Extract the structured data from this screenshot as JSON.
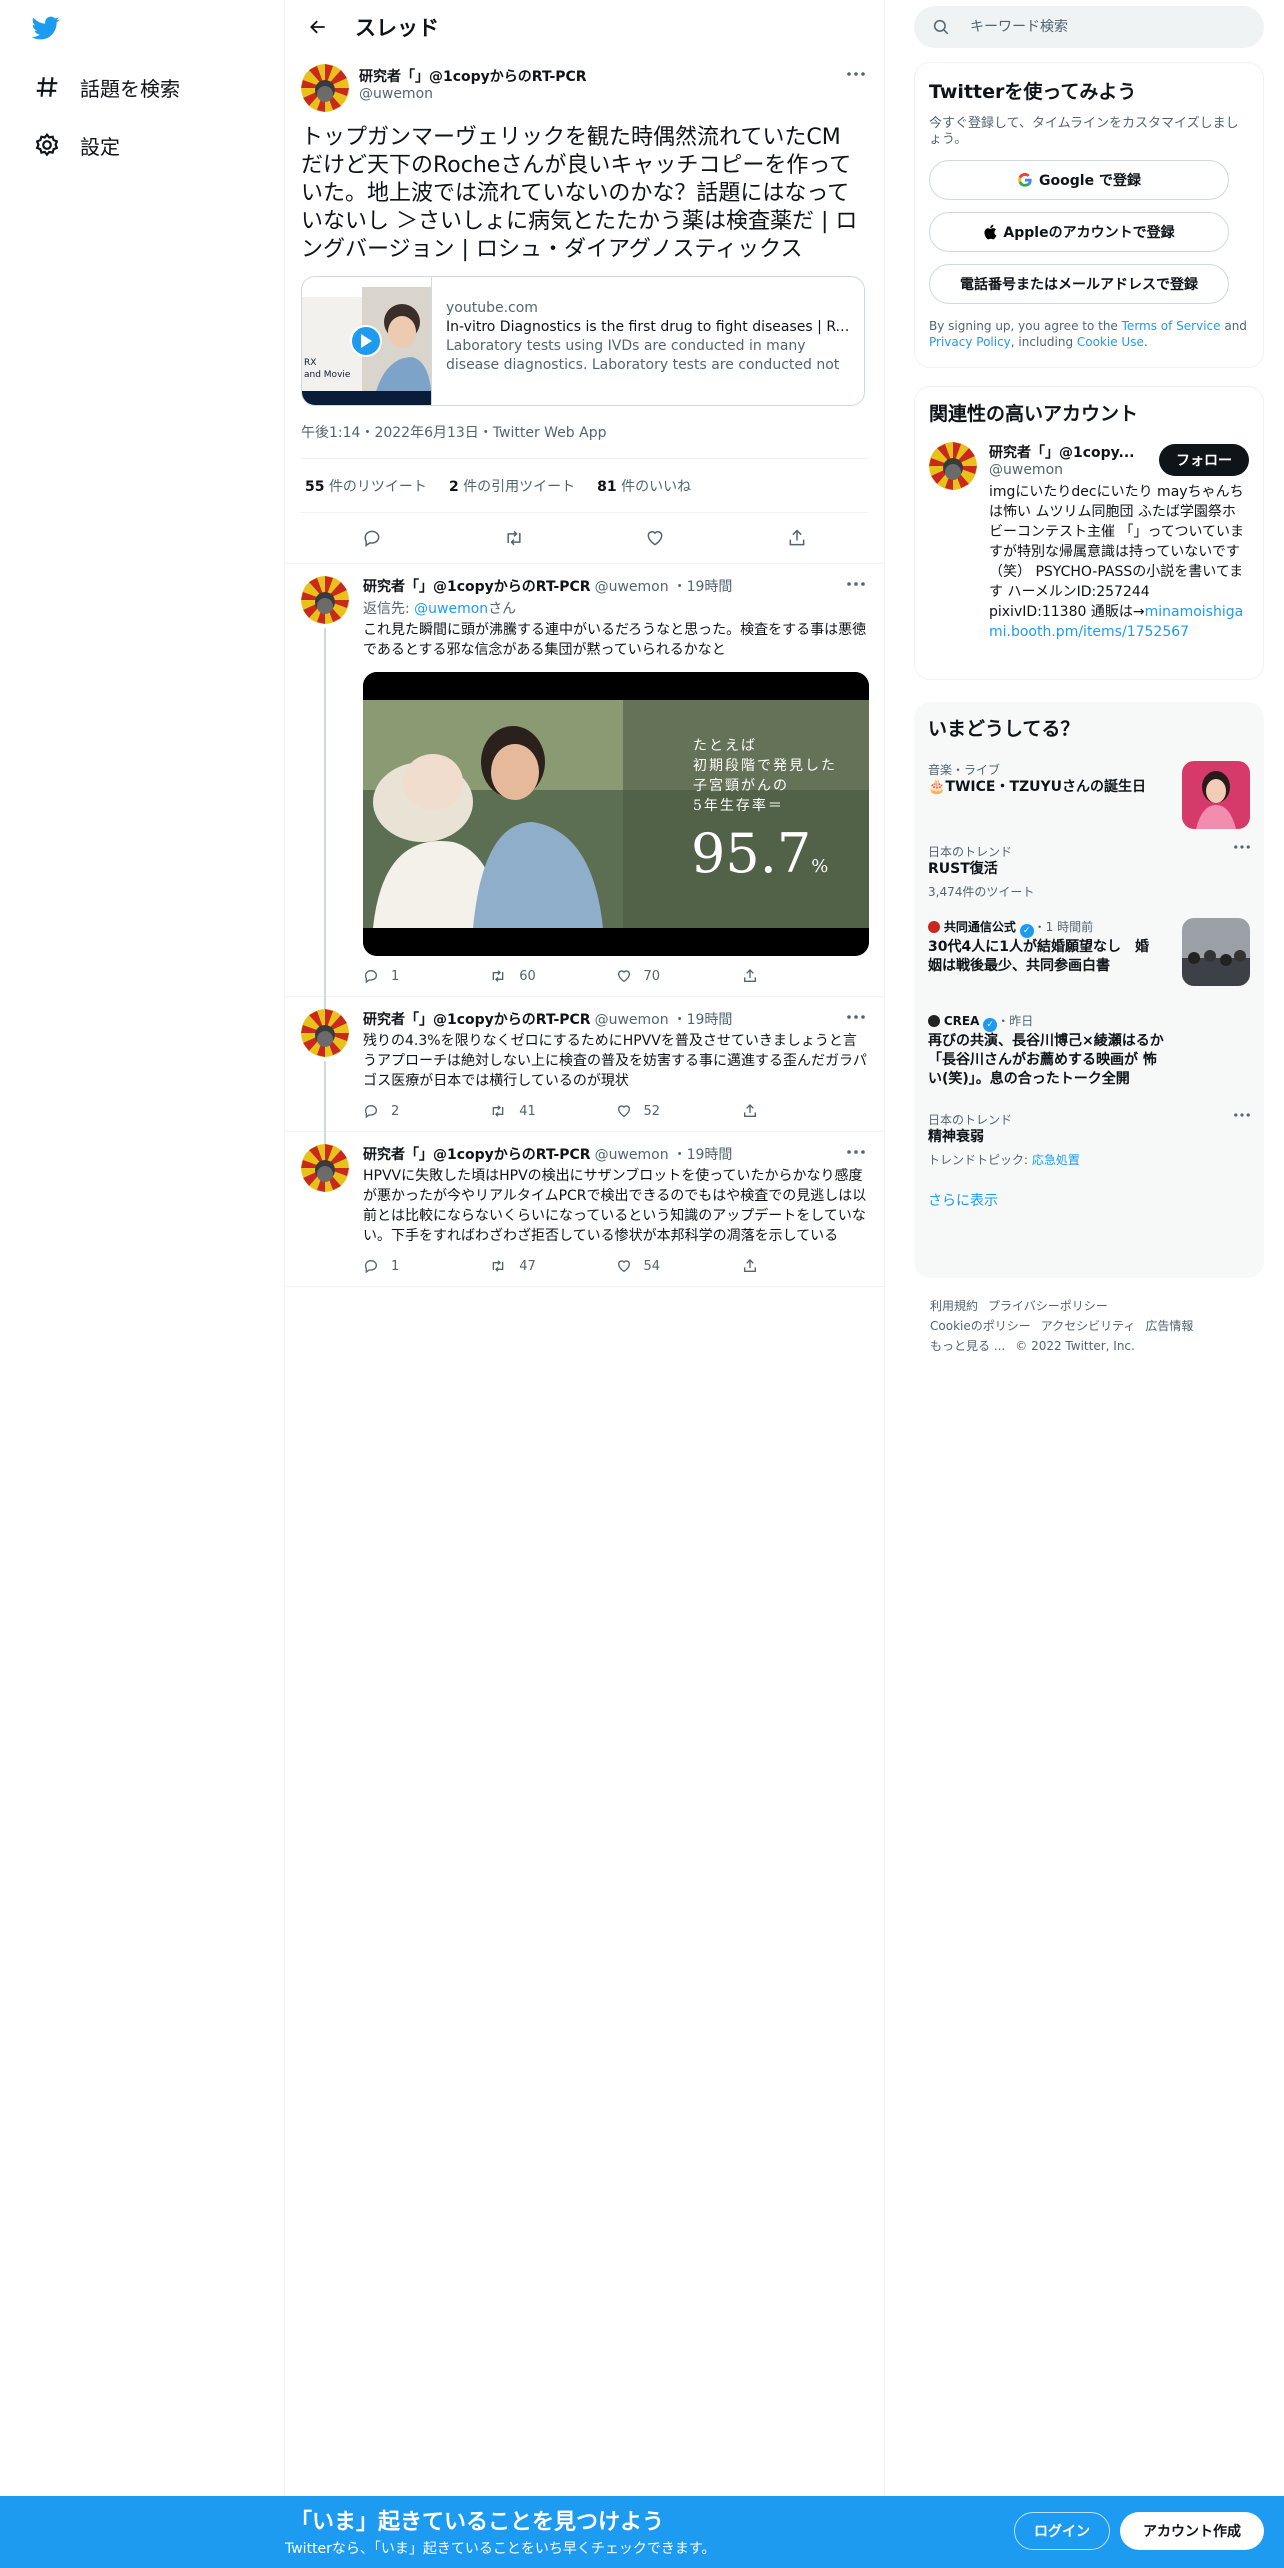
{
  "nav": {
    "explore_label": "話題を検索",
    "settings_label": "設定"
  },
  "header": {
    "title": "スレッド"
  },
  "focus_tweet": {
    "display_name": "研究者「」@1copyからのRT-PCR",
    "handle": "@uwemon",
    "text": "トップガンマーヴェリックを観た時偶然流れていたCMだけど天下のRocheさんが良いキャッチコピーを作っていた。地上波では流れていないのかな？話題にはなっていないし ＞さいしょに病気とたたかう薬は検査薬だ | ロングバージョン | ロシュ・ダイアグノスティックス",
    "card": {
      "domain": "youtube.com",
      "title": "In-vitro Diagnostics is the first drug to fight diseases | Roch...",
      "description": "Laboratory tests using IVDs are conducted in many disease diagnostics. Laboratory tests are conducted not only in the ..."
    },
    "meta": "午後1:14・2022年6月13日・Twitter Web App",
    "stats": {
      "retweets": "55",
      "retweets_label": "件のリツイート",
      "quotes": "2",
      "quotes_label": "件の引用ツイート",
      "likes": "81",
      "likes_label": "件のいいね"
    }
  },
  "replies": [
    {
      "display_name": "研究者「」@1copyからのRT-PCR",
      "handle": "@uwemon",
      "time": "・19時間",
      "reply_to_prefix": "返信先: ",
      "reply_to_handle": "@uwemon",
      "reply_to_suffix": "さん",
      "text": "これ見た瞬間に頭が沸騰する連中がいるだろうなと思った。検査をする事は悪徳であるとする邪な信念がある集団が黙っていられるかなと",
      "media_caption_lines": [
        "たとえば",
        "初期段階で発見した",
        "子宮頸がんの",
        "5年生存率＝"
      ],
      "media_big_number": "95.7",
      "media_unit": "%",
      "replies": "1",
      "retweets": "60",
      "likes": "70"
    },
    {
      "display_name": "研究者「」@1copyからのRT-PCR",
      "handle": "@uwemon",
      "time": "・19時間",
      "text": "残りの4.3%を限りなくゼロにするためにHPVVを普及させていきましょうと言うアプローチは絶対しない上に検査の普及を妨害する事に邁進する歪んだガラパゴス医療が日本では横行しているのが現状",
      "replies": "2",
      "retweets": "41",
      "likes": "52"
    },
    {
      "display_name": "研究者「」@1copyからのRT-PCR",
      "handle": "@uwemon",
      "time": "・19時間",
      "text": "HPVVに失敗した頃はHPVの検出にサザンブロットを使っていたからかなり感度が悪かったが今やリアルタイムPCRで検出できるのでもはや検査での見逃しは以前とは比較にならないくらいになっているという知識のアップデートをしていない。下手をすればわざわざ拒否している惨状が本邦科学の凋落を示している",
      "replies": "1",
      "retweets": "47",
      "likes": "54"
    }
  ],
  "search": {
    "placeholder": "キーワード検索"
  },
  "signup": {
    "title": "Twitterを使ってみよう",
    "subtitle": "今すぐ登録して、タイムラインをカスタマイズしましょう。",
    "google_label": "Google で登録",
    "apple_label": "Appleのアカウントで登録",
    "phone_label": "電話番号またはメールアドレスで登録",
    "fine_prefix": "By signing up, you agree to the ",
    "terms": "Terms of Service",
    "fine_and": " and ",
    "privacy": "Privacy Policy",
    "fine_including": ", including ",
    "cookie": "Cookie Use",
    "fine_end": "."
  },
  "related": {
    "title": "関連性の高いアカウント",
    "display_name": "研究者「」@1copy...",
    "handle": "@uwemon",
    "follow_label": "フォロー",
    "bio": "imgにいたりdecにいたり mayちゃんちは怖い ムツリム同胞団 ふたば学園祭ホビーコンテスト主催 「」ってついていますが特別な帰属意識は持っていないです（笑） PSYCHO-PASSの小説を書いてます ハーメルンID:257244 pixivID:11380 通販は→",
    "bio_link": "minamoishigami.booth.pm/items/1752567"
  },
  "trends": {
    "title": "いまどうしてる？",
    "items": [
      {
        "meta": "音楽・ライブ",
        "name": "🎂TWICE・TZUYUさんの誕生日",
        "count": ""
      },
      {
        "meta": "日本のトレンド",
        "name": "RUST復活",
        "count": "3,474件のツイート"
      },
      {
        "meta_source": "共同通信公式",
        "meta_time": "・1 時間前",
        "name": "30代4人に1人が結婚願望なし　婚姻は戦後最少、共同参画白書",
        "count": ""
      },
      {
        "meta_source": "CREA",
        "meta_time": "・昨日",
        "name": "再びの共演、長谷川博己×綾瀬はるか「長谷川さんがお薦めする映画が 怖い(笑)」。息の合ったトーク全開",
        "count": ""
      },
      {
        "meta": "日本のトレンド",
        "name": "精神衰弱",
        "count_prefix": "トレンドトピック: ",
        "count_link": "応急処置"
      }
    ],
    "show_more": "さらに表示"
  },
  "footer": {
    "links": [
      "利用規約",
      "プライバシーポリシー",
      "Cookieのポリシー",
      "アクセシビリティ",
      "広告情報",
      "もっと見る ...",
      "© 2022 Twitter, Inc."
    ]
  },
  "banner": {
    "title": "「いま」起きていることを見つけよう",
    "subtitle": "Twitterなら、「いま」起きていることをいち早くチェックできます。",
    "login_label": "ログイン",
    "signup_label": "アカウント作成"
  },
  "colors": {
    "brand": "#1d9bf0",
    "text": "#0f1419",
    "secondary": "#536471"
  }
}
